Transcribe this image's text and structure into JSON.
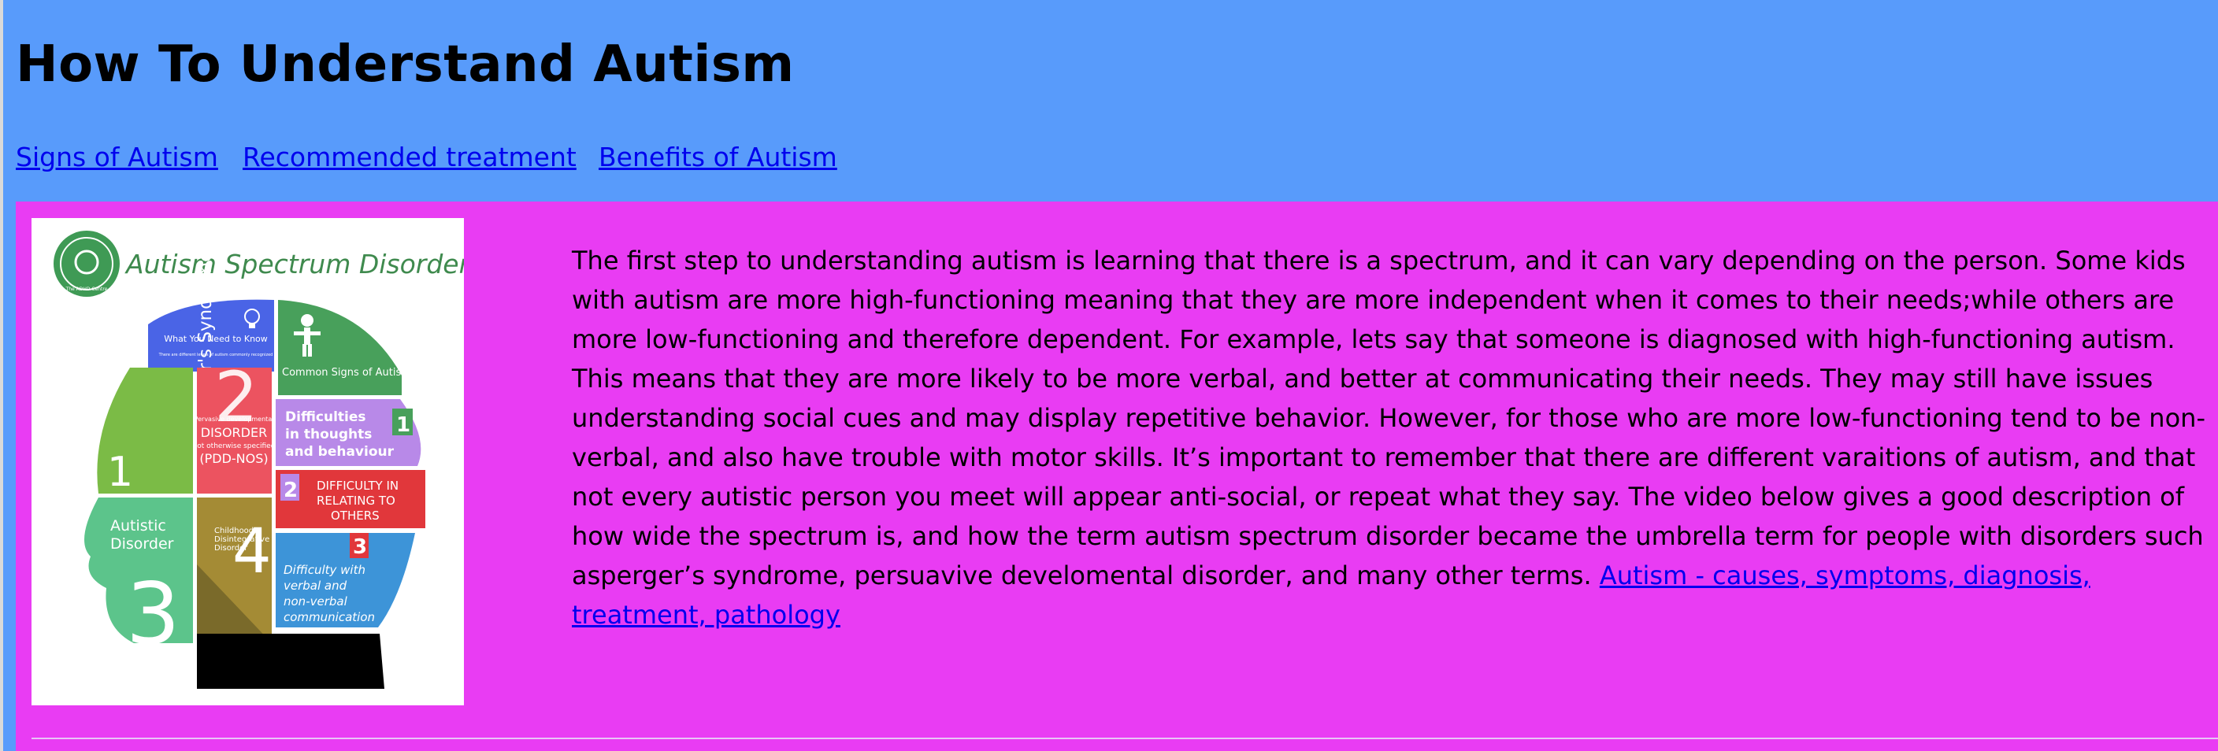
{
  "page": {
    "title": "How To Understand Autism"
  },
  "nav": {
    "links": [
      "Signs of Autism",
      "Recommended treatment",
      "Benefits of Autism"
    ]
  },
  "figure": {
    "heading": "Autism Spectrum Disorders",
    "logo_text": "The ADHD Centre",
    "sections": {
      "top_banner": "What You Need to Know",
      "top_banner_sub": "There are different levels of autism commonly recognized",
      "common_signs": "Common Signs of Autism Found in Children",
      "aspergers": "Asperger's Syndrome",
      "aspergers_number": "1",
      "pdd_small": "Pervasive developmental",
      "pdd_main": "DISORDER",
      "pdd_sub": "not otherwise specified",
      "pdd_abbr": "(PDD-NOS)",
      "pdd_number": "2",
      "thoughts_line1": "Difficulties",
      "thoughts_line2": "in thoughts",
      "thoughts_line3": "and behaviour",
      "thoughts_number": "1",
      "relating_number": "2",
      "relating_line1": "DIFFICULTY IN",
      "relating_line2": "RELATING TO",
      "relating_line3": "OTHERS",
      "autistic_line1": "Autistic",
      "autistic_line2": "Disorder",
      "autistic_number": "3",
      "cdd_line1": "Childhood",
      "cdd_line2": "Disintegrative",
      "cdd_line3": "Disorder",
      "cdd_number": "4",
      "verbal_number": "3",
      "verbal_line1": "Difficulty with",
      "verbal_line2": "verbal and",
      "verbal_line3": "non-verbal",
      "verbal_line4": "communication"
    }
  },
  "article": {
    "body": "The first step to understanding autism is learning that there is a spectrum, and it can vary depending on the person. Some kids with autism are more high-functioning meaning that they are more independent when it comes to their needs;while others are more low-functioning and therefore dependent. For example, lets say that someone is diagnosed with high-functioning autism. This means that they are more likely to be more verbal, and better at communicating their needs. They may still have issues understanding social cues and may display repetitive behavior. However, for those who are more low-functioning tend to be non-verbal, and also have trouble with motor skills. It’s important to remember that there are different varaitions of autism, and that not every autistic person you meet will appear anti-social, or repeat what they say. The video below gives a good description of how wide the spectrum is, and how the term autism spectrum disorder became the umbrella term for people with disorders such asperger’s syndrome, persuavive develomental disorder, and many other terms. ",
    "link_text": "Autism - causes, symptoms, diagnosis, treatment, pathology"
  },
  "colors": {
    "page_background": "#589bfb",
    "panel_background": "#e93cf3",
    "link": "#0000ee"
  }
}
